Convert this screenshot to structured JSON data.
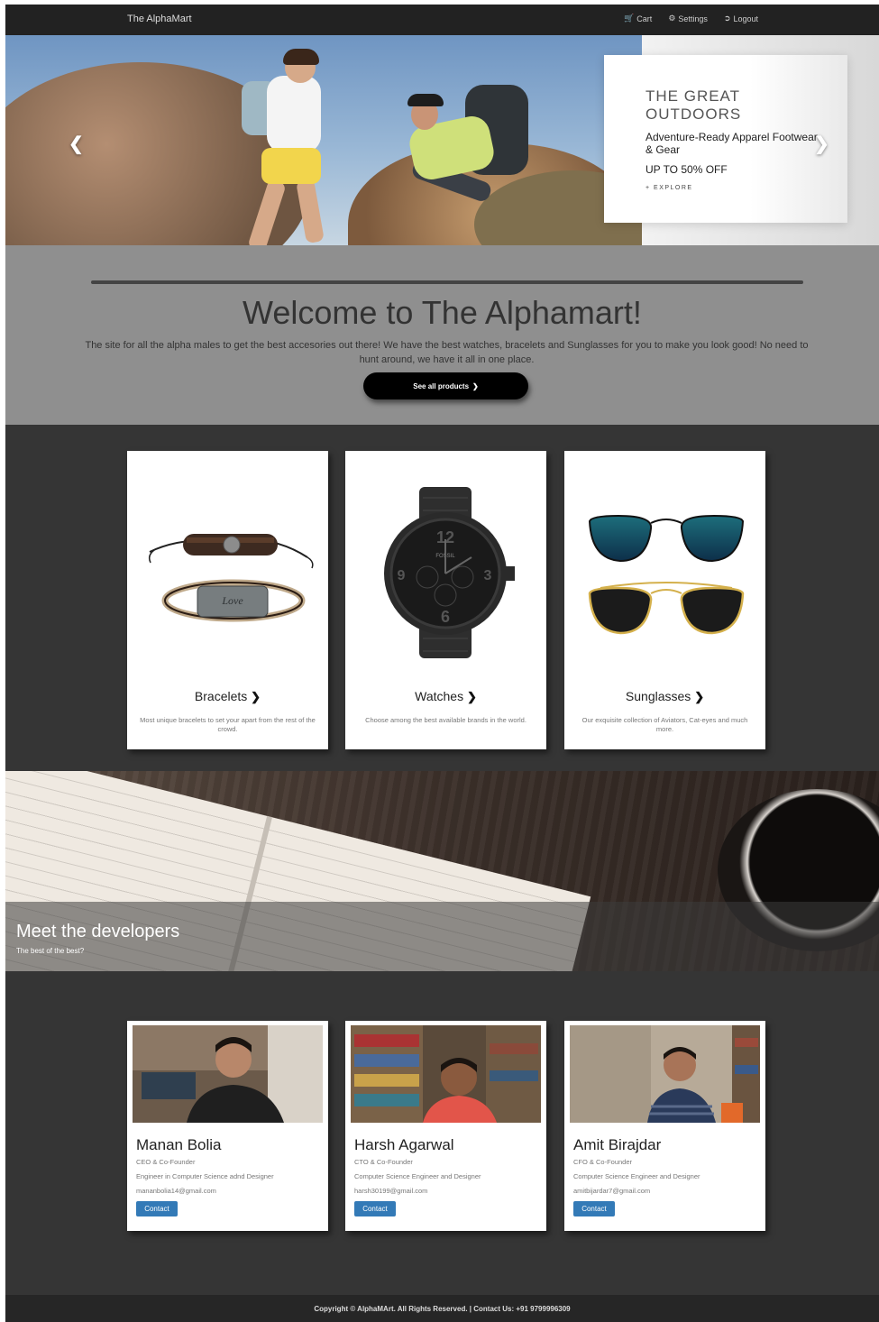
{
  "navbar": {
    "brand": "The AlphaMart",
    "links": [
      {
        "label": "Cart",
        "icon": "cart-icon"
      },
      {
        "label": "Settings",
        "icon": "gear-icon"
      },
      {
        "label": "Logout",
        "icon": "logout-icon"
      }
    ]
  },
  "hero": {
    "promo_title": "THE GREAT OUTDOORS",
    "promo_subtitle": "Adventure-Ready Apparel Footwear & Gear",
    "promo_offer": "UP TO 50% OFF",
    "promo_cta": "+ EXPLORE",
    "prev_icon": "chevron-left-icon",
    "next_icon": "chevron-right-icon"
  },
  "welcome": {
    "heading": "Welcome to The Alphamart!",
    "text": "The site for all the alpha males to get the best accesories out there! We have the best watches, bracelets and Sunglasses for you to make you look good! No need to hunt around, we have it all in one place.",
    "button": "See all products"
  },
  "categories": [
    {
      "title": "Bracelets",
      "desc": "Most unique bracelets to set your apart from the rest of the crowd."
    },
    {
      "title": "Watches",
      "desc": "Choose among the best available brands in the world."
    },
    {
      "title": "Sunglasses",
      "desc": "Our exquisite collection of Aviators, Cat-eyes and much more."
    }
  ],
  "watch_brand": "FOSSIL",
  "bracelet_engraving": "Love",
  "developers_banner": {
    "title": "Meet the developers",
    "subtitle": "The best of the best?"
  },
  "developers": [
    {
      "name": "Manan Bolia",
      "role": "CEO & Co-Founder",
      "bio": "Engineer in Computer Science adnd Designer",
      "email": "mananbolia14@gmail.com",
      "button": "Contact"
    },
    {
      "name": "Harsh Agarwal",
      "role": "CTO & Co-Founder",
      "bio": "Computer Science Engineer and Designer",
      "email": "harsh30199@gmail.com",
      "button": "Contact"
    },
    {
      "name": "Amit Birajdar",
      "role": "CFO & Co-Founder",
      "bio": "Computer Science Engineer and Designer",
      "email": "amitbijardar7@gmail.com",
      "button": "Contact"
    }
  ],
  "footer": {
    "text": "Copyright © AlphaMArt. All Rights Reserved. | Contact Us: +91 9799996309"
  },
  "colors": {
    "navbar": "#222222",
    "body": "#353535",
    "welcome_bg": "#8f8f8f",
    "contact_button": "#337ab7"
  }
}
